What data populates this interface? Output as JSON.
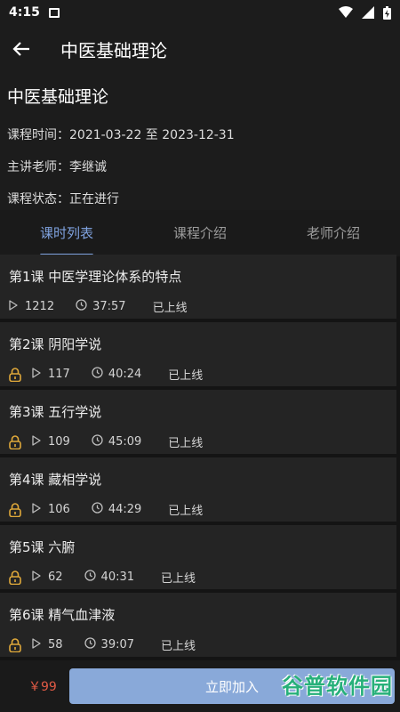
{
  "status_bar": {
    "time": "4:15"
  },
  "app_bar": {
    "title": "中医基础理论"
  },
  "course": {
    "name": "中医基础理论",
    "time_label": "课程时间：",
    "time_value": "2021-03-22 至 2023-12-31",
    "teacher_label": "主讲老师：",
    "teacher_value": "李继诚",
    "status_label": "课程状态：",
    "status_value": "正在进行"
  },
  "tabs": [
    {
      "label": "课时列表",
      "active": true
    },
    {
      "label": "课程介绍",
      "active": false
    },
    {
      "label": "老师介绍",
      "active": false
    }
  ],
  "lessons": [
    {
      "title": "第1课 中医学理论体系的特点",
      "locked": false,
      "plays": "1212",
      "duration": "37:57",
      "status": "已上线"
    },
    {
      "title": "第2课 阴阳学说",
      "locked": true,
      "plays": "117",
      "duration": "40:24",
      "status": "已上线"
    },
    {
      "title": "第3课 五行学说",
      "locked": true,
      "plays": "109",
      "duration": "45:09",
      "status": "已上线"
    },
    {
      "title": "第4课 藏相学说",
      "locked": true,
      "plays": "106",
      "duration": "44:29",
      "status": "已上线"
    },
    {
      "title": "第5课 六腑",
      "locked": true,
      "plays": "62",
      "duration": "40:31",
      "status": "已上线"
    },
    {
      "title": "第6课 精气血津液",
      "locked": true,
      "plays": "58",
      "duration": "39:07",
      "status": "已上线"
    }
  ],
  "bottom_bar": {
    "price": "￥99",
    "join_label": "立即加入"
  },
  "watermark": "谷普软件园",
  "colors": {
    "accent": "#7fa2df",
    "lock": "#e0a93a",
    "price": "#e05a45",
    "button": "#89a9d9"
  }
}
